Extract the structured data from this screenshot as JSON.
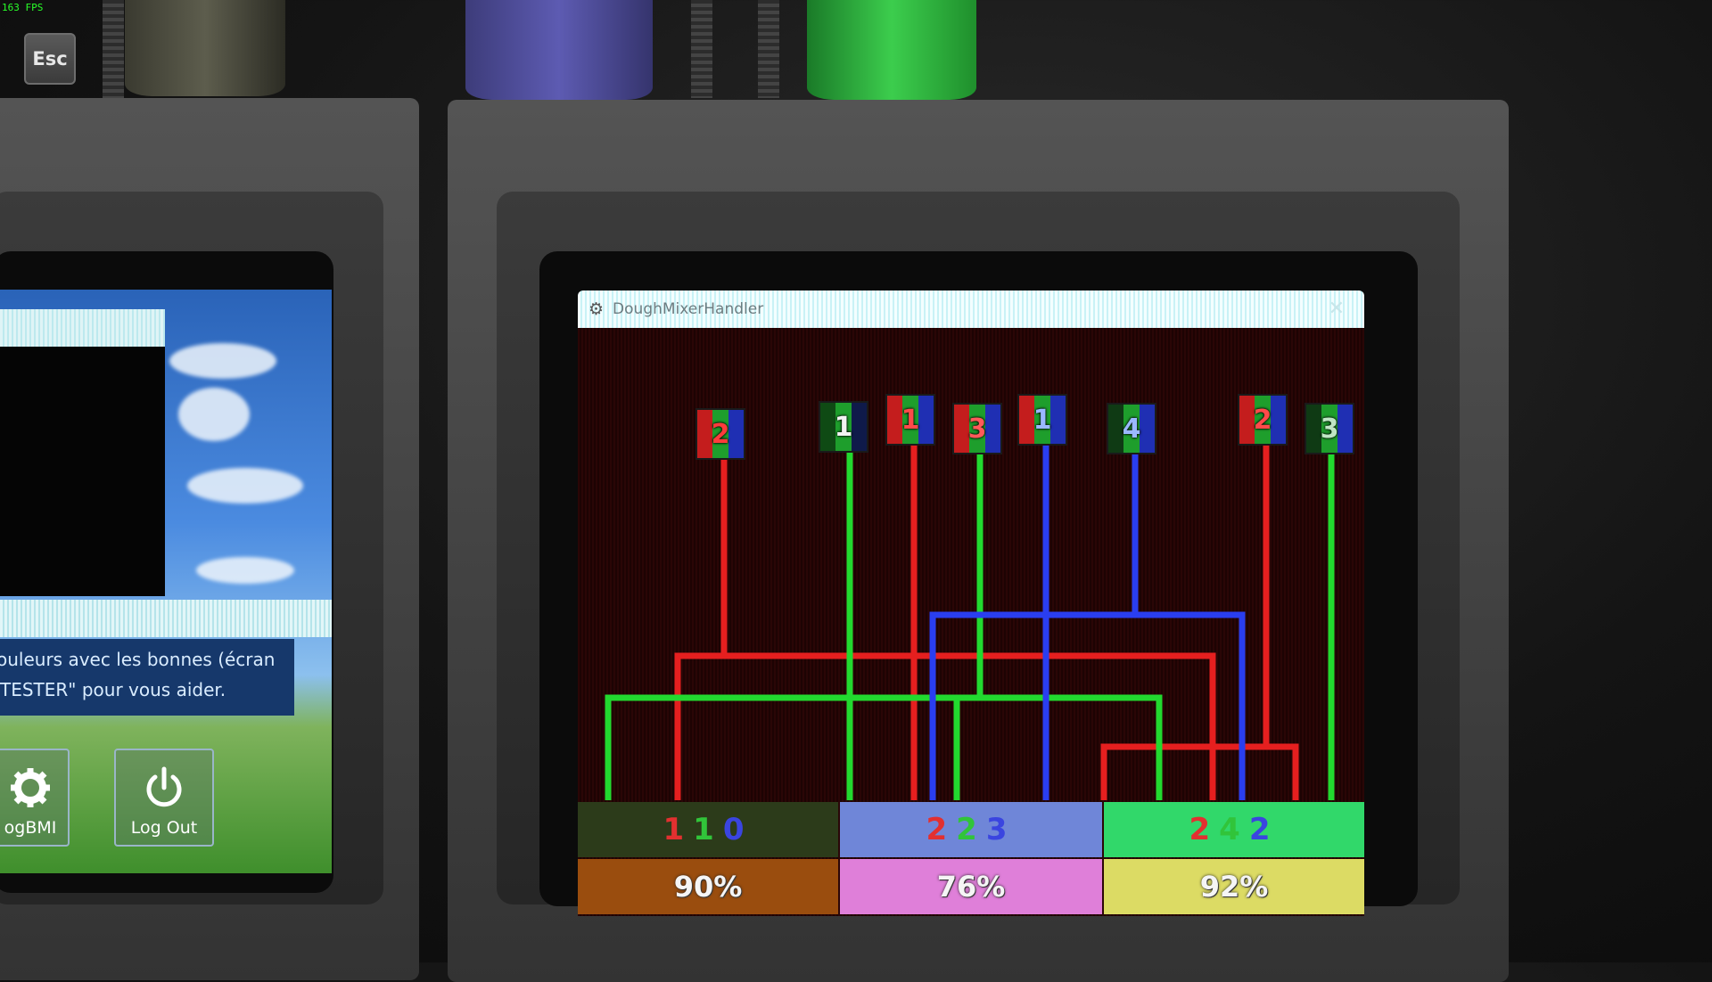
{
  "hud": {
    "fps": "163 FPS",
    "esc_label": "Esc"
  },
  "left_monitor": {
    "message_line1": "ouleurs avec les bonnes (écran",
    "message_line2": "TESTER\" pour vous aider.",
    "settings_label": "ogBMI",
    "logout_label": "Log Out"
  },
  "window": {
    "title": "DoughMixerHandler",
    "nodes": [
      {
        "label": "2",
        "digit_color": "#ff3b3b"
      },
      {
        "label": "1",
        "digit_color": "#f2f2f2"
      },
      {
        "label": "1",
        "digit_color": "#ff4a4a"
      },
      {
        "label": "3",
        "digit_color": "#ff5a5a"
      },
      {
        "label": "1",
        "digit_color": "#9bb8ff"
      },
      {
        "label": "4",
        "digit_color": "#9bb8ff"
      },
      {
        "label": "2",
        "digit_color": "#ff4a4a"
      },
      {
        "label": "3",
        "digit_color": "#bfe6c4"
      }
    ],
    "codes": [
      {
        "digits": [
          "1",
          "1",
          "0"
        ],
        "background": "#2c3b1a"
      },
      {
        "digits": [
          "2",
          "2",
          "3"
        ],
        "background": "#6f86d8"
      },
      {
        "digits": [
          "2",
          "4",
          "2"
        ],
        "background": "#31d86a"
      }
    ],
    "percents": [
      {
        "value": "90%",
        "background": "#9a4d0e"
      },
      {
        "value": "76%",
        "background": "#df7fd9"
      },
      {
        "value": "92%",
        "background": "#dcdb64"
      }
    ],
    "digit_colors": [
      "#e23030",
      "#31c43a",
      "#3a45e0"
    ]
  }
}
